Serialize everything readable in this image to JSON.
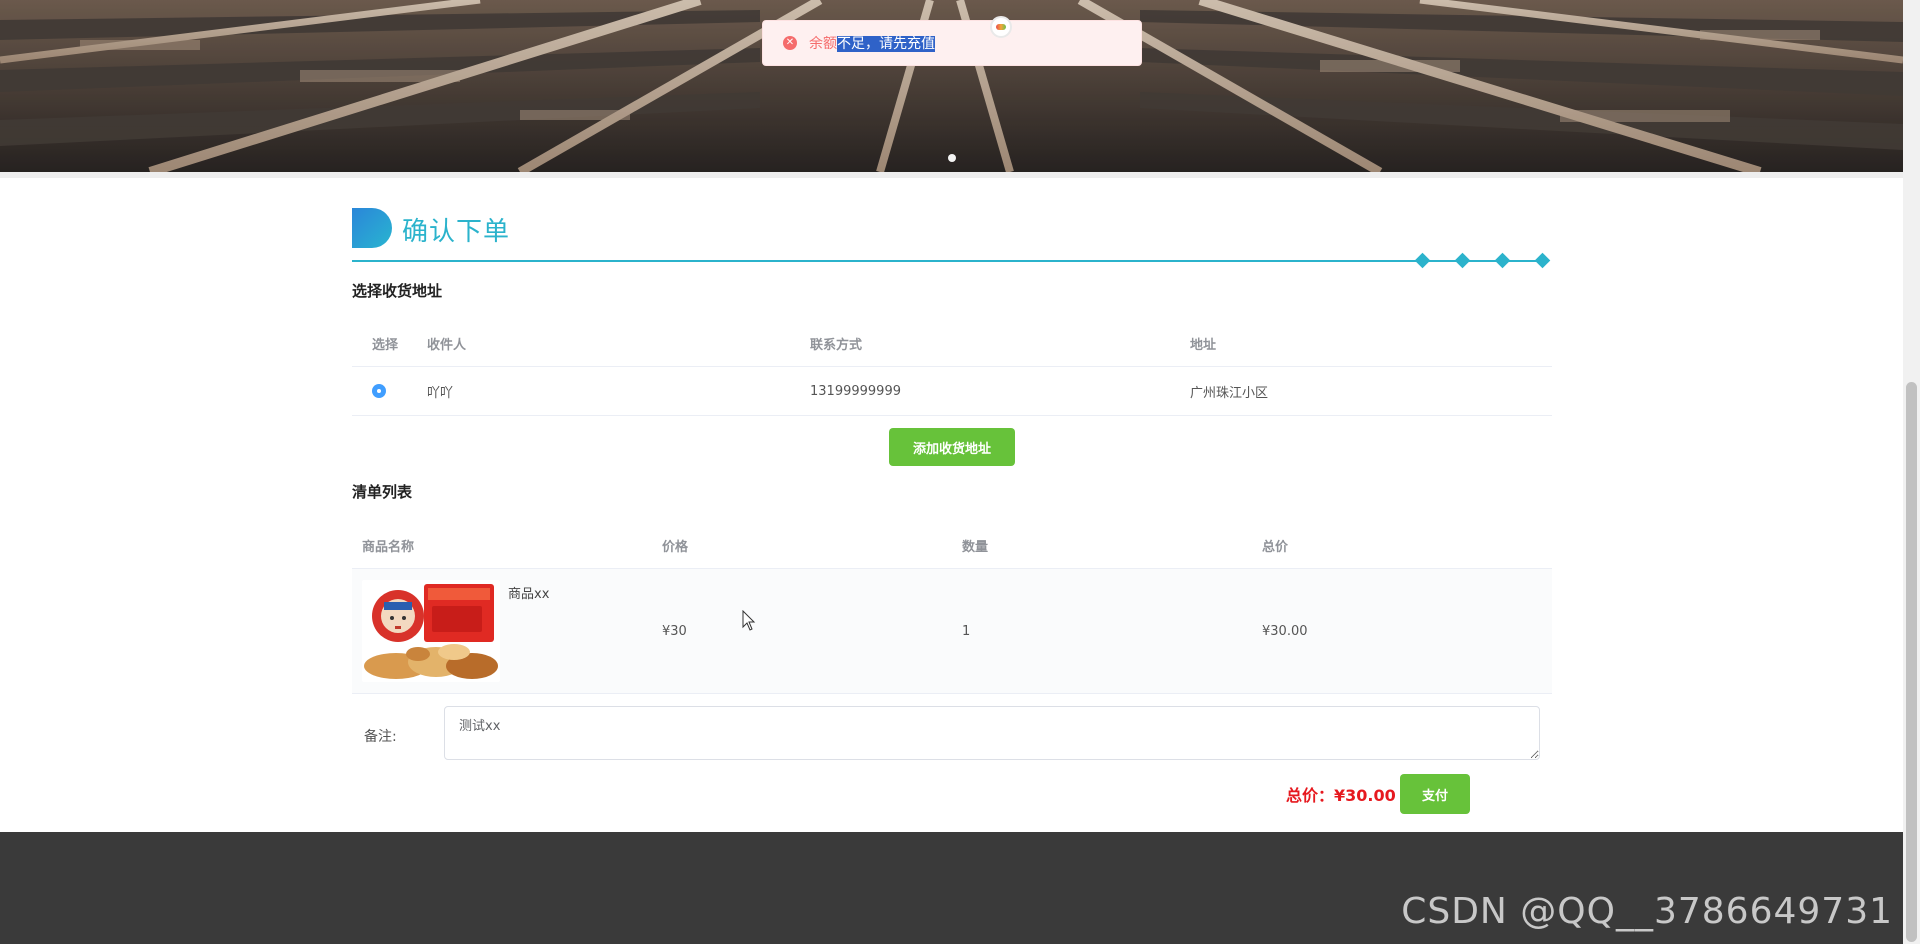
{
  "toast": {
    "icon": "close-circle-icon",
    "text_prefix": "余额",
    "text_selected": "不足，请先充值"
  },
  "page": {
    "title": "确认下单"
  },
  "address_section": {
    "title": "选择收货地址",
    "headers": {
      "select": "选择",
      "recipient": "收件人",
      "contact": "联系方式",
      "address": "地址"
    },
    "rows": [
      {
        "selected": true,
        "recipient": "吖吖",
        "contact": "13199999999",
        "address": "广州珠江小区"
      }
    ],
    "add_button": "添加收货地址"
  },
  "items_section": {
    "title": "清单列表",
    "headers": {
      "name": "商品名称",
      "price": "价格",
      "quantity": "数量",
      "total": "总价"
    },
    "rows": [
      {
        "name": "商品xx",
        "price": "¥30",
        "quantity": "1",
        "total": "¥30.00"
      }
    ]
  },
  "remark": {
    "label": "备注:",
    "value": "测试xx"
  },
  "summary": {
    "total_label": "总价：¥30.00",
    "pay_button": "支付"
  },
  "watermark": {
    "text": "CSDN @QQ__3786649731"
  },
  "colors": {
    "accent": "#2bb3cc",
    "success": "#67c23a",
    "danger": "#e6191f",
    "radio": "#409eff"
  }
}
